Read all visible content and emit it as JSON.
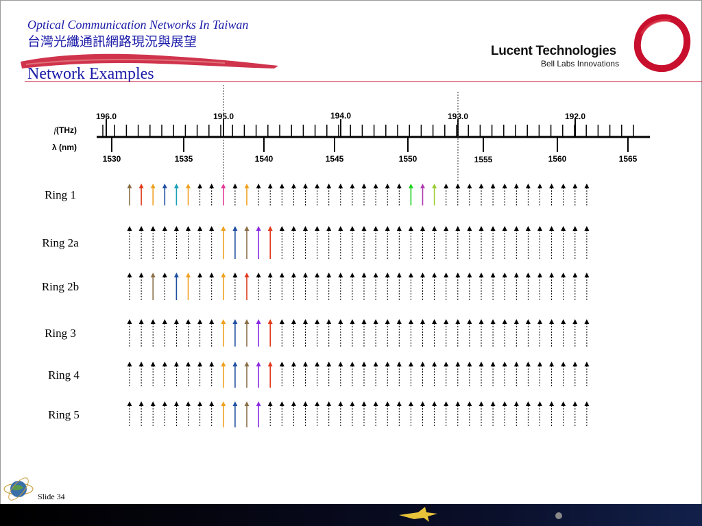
{
  "header": {
    "title": "Optical Communication Networks In Taiwan",
    "subtitle": "台灣光纖通訊網路現況與展望",
    "page_title": "Network Examples"
  },
  "brand": {
    "name": "Lucent Technologies",
    "tagline": "Bell Labs Innovations",
    "logo_color": "#c8102e"
  },
  "axis": {
    "freq_label_prefix": "f",
    "freq_label": "(THz)",
    "wavelength_label": "λ (nm)",
    "freq_ticks": [
      "196.0",
      "195.0",
      "194.0",
      "193.0",
      "192.0"
    ],
    "wavelength_ticks": [
      "1530",
      "1535",
      "1540",
      "1545",
      "1550",
      "1555",
      "1560",
      "1565"
    ]
  },
  "channel_count": 40,
  "colors": {
    "brown": "#8b6f47",
    "red": "#e0391c",
    "orange": "#f0a020",
    "blue": "#1f4f9f",
    "teal": "#1aa0b8",
    "pink": "#e23c9a",
    "green": "#1ed01e",
    "magenta": "#b03cb0",
    "lime": "#9acd32",
    "purple": "#8a2be2",
    "idle": "#000000"
  },
  "rings": [
    {
      "name": "Ring 1",
      "channels": {
        "0": "brown",
        "1": "red",
        "2": "orange",
        "3": "blue",
        "4": "teal",
        "5": "orange",
        "8": "pink",
        "10": "orange",
        "24": "green",
        "25": "magenta",
        "26": "lime"
      }
    },
    {
      "name": "Ring 2a",
      "channels": {
        "8": "orange",
        "9": "blue",
        "10": "brown",
        "11": "purple",
        "12": "red"
      }
    },
    {
      "name": "Ring 2b",
      "channels": {
        "2": "brown",
        "4": "blue",
        "5": "orange",
        "8": "orange",
        "10": "red"
      }
    },
    {
      "name": "Ring 3",
      "channels": {
        "8": "orange",
        "9": "blue",
        "10": "brown",
        "11": "purple",
        "12": "red"
      }
    },
    {
      "name": "Ring 4",
      "channels": {
        "8": "orange",
        "9": "blue",
        "10": "brown",
        "11": "purple",
        "12": "red"
      }
    },
    {
      "name": "Ring 5",
      "channels": {
        "8": "orange",
        "9": "blue",
        "10": "brown",
        "11": "purple"
      }
    }
  ],
  "footer": {
    "slide_label": "Slide 34"
  }
}
